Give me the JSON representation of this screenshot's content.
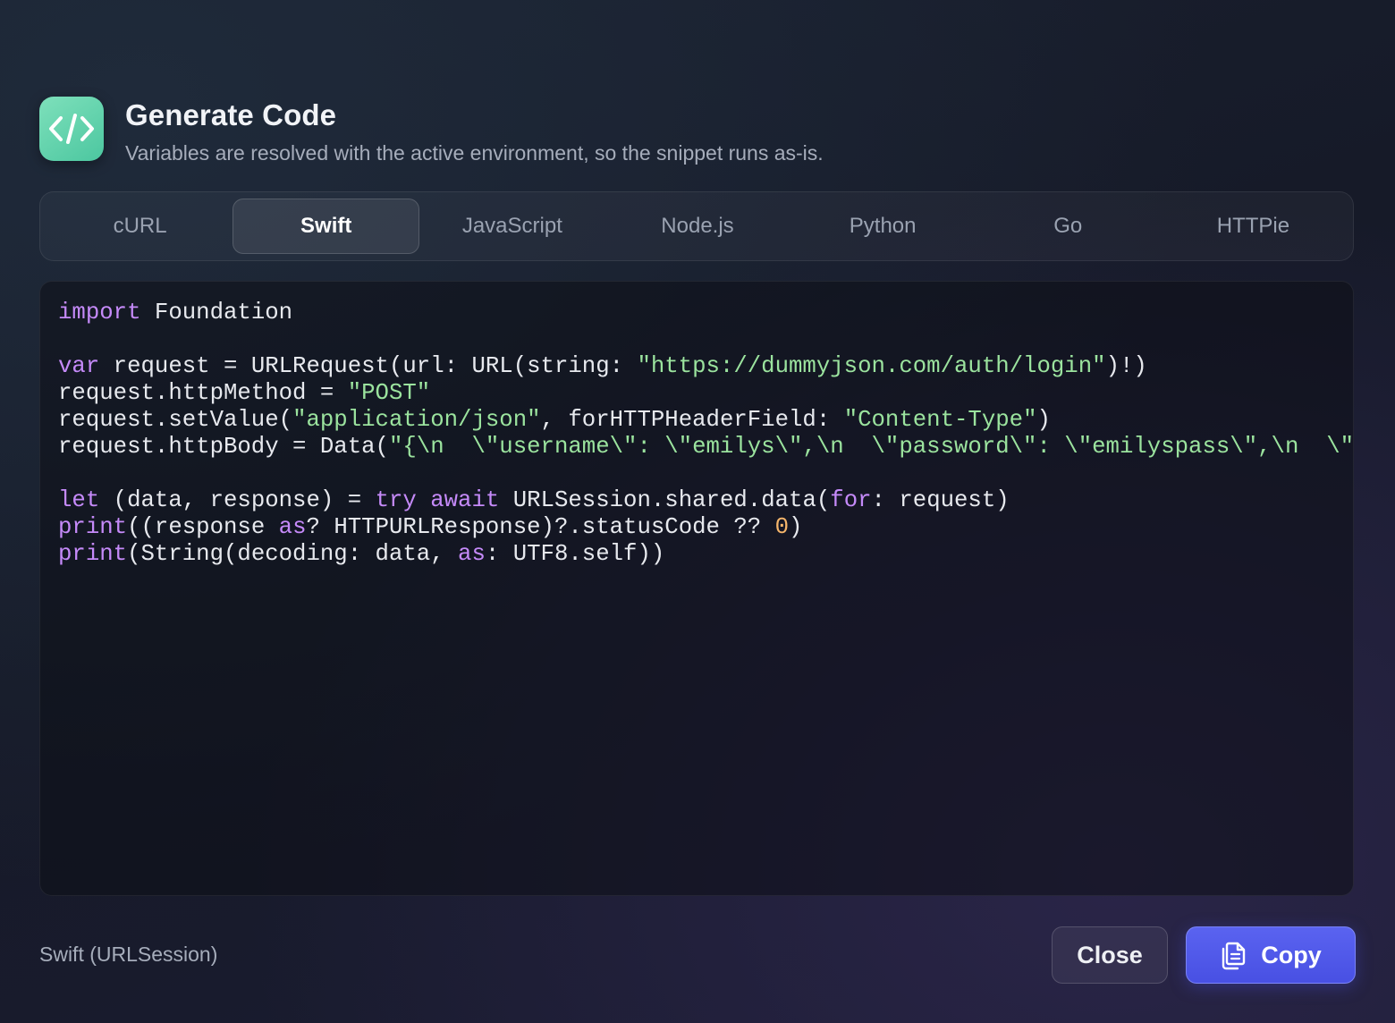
{
  "dialog": {
    "title": "Generate Code",
    "subtitle": "Variables are resolved with the active environment, so the snippet runs as-is.",
    "icon": "code-brackets-icon",
    "icon_color": "#5fd3ad"
  },
  "tabs": [
    {
      "label": "cURL",
      "active": false
    },
    {
      "label": "Swift",
      "active": true
    },
    {
      "label": "JavaScript",
      "active": false
    },
    {
      "label": "Node.js",
      "active": false
    },
    {
      "label": "Python",
      "active": false
    },
    {
      "label": "Go",
      "active": false
    },
    {
      "label": "HTTPie",
      "active": false
    }
  ],
  "code": {
    "language": "Swift",
    "colors": {
      "keyword": "#c58af9",
      "string": "#9be39e",
      "number": "#f5b56b",
      "plain": "#e7e9ee"
    },
    "lines": [
      [
        {
          "t": "kw",
          "v": "import"
        },
        {
          "t": "plain",
          "v": " Foundation"
        }
      ],
      [],
      [
        {
          "t": "kw",
          "v": "var"
        },
        {
          "t": "plain",
          "v": " request = URLRequest(url: URL(string: "
        },
        {
          "t": "str",
          "v": "\"https://dummyjson.com/auth/login\""
        },
        {
          "t": "plain",
          "v": ")!)"
        }
      ],
      [
        {
          "t": "plain",
          "v": "request.httpMethod = "
        },
        {
          "t": "str",
          "v": "\"POST\""
        }
      ],
      [
        {
          "t": "plain",
          "v": "request.setValue("
        },
        {
          "t": "str",
          "v": "\"application/json\""
        },
        {
          "t": "plain",
          "v": ", forHTTPHeaderField: "
        },
        {
          "t": "str",
          "v": "\"Content-Type\""
        },
        {
          "t": "plain",
          "v": ")"
        }
      ],
      [
        {
          "t": "plain",
          "v": "request.httpBody = Data("
        },
        {
          "t": "str",
          "v": "\"{\\n  \\\"username\\\": \\\"emilys\\\",\\n  \\\"password\\\": \\\"emilyspass\\\",\\n  \\\""
        }
      ],
      [],
      [
        {
          "t": "kw",
          "v": "let"
        },
        {
          "t": "plain",
          "v": " (data, response) = "
        },
        {
          "t": "kw",
          "v": "try await"
        },
        {
          "t": "plain",
          "v": " URLSession.shared.data("
        },
        {
          "t": "kw",
          "v": "for"
        },
        {
          "t": "plain",
          "v": ": request)"
        }
      ],
      [
        {
          "t": "kw",
          "v": "print"
        },
        {
          "t": "plain",
          "v": "((response "
        },
        {
          "t": "kw",
          "v": "as"
        },
        {
          "t": "plain",
          "v": "? HTTPURLResponse)?.statusCode ?? "
        },
        {
          "t": "num",
          "v": "0"
        },
        {
          "t": "plain",
          "v": ")"
        }
      ],
      [
        {
          "t": "kw",
          "v": "print"
        },
        {
          "t": "plain",
          "v": "(String(decoding: data, "
        },
        {
          "t": "kw",
          "v": "as"
        },
        {
          "t": "plain",
          "v": ": UTF8.self))"
        }
      ]
    ]
  },
  "footer": {
    "label": "Swift (URLSession)",
    "close_label": "Close",
    "copy_label": "Copy",
    "copy_icon": "copy-icon",
    "copy_color": "#4f58e8"
  }
}
